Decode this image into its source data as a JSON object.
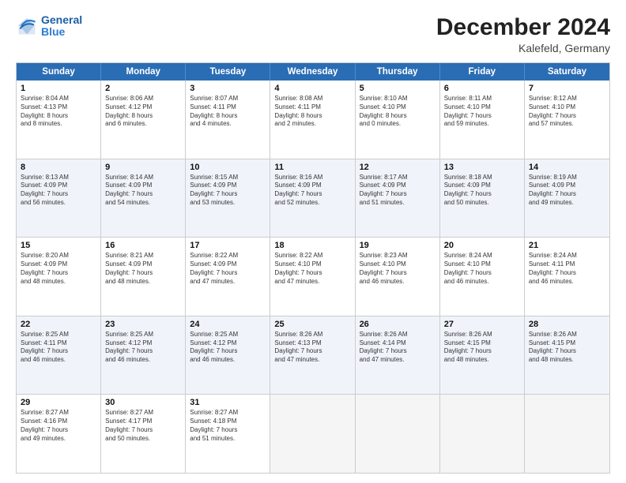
{
  "header": {
    "logo_general": "General",
    "logo_blue": "Blue",
    "month_title": "December 2024",
    "location": "Kalefeld, Germany"
  },
  "days_of_week": [
    "Sunday",
    "Monday",
    "Tuesday",
    "Wednesday",
    "Thursday",
    "Friday",
    "Saturday"
  ],
  "weeks": [
    [
      {
        "day": "1",
        "lines": [
          "Sunrise: 8:04 AM",
          "Sunset: 4:13 PM",
          "Daylight: 8 hours",
          "and 8 minutes."
        ]
      },
      {
        "day": "2",
        "lines": [
          "Sunrise: 8:06 AM",
          "Sunset: 4:12 PM",
          "Daylight: 8 hours",
          "and 6 minutes."
        ]
      },
      {
        "day": "3",
        "lines": [
          "Sunrise: 8:07 AM",
          "Sunset: 4:11 PM",
          "Daylight: 8 hours",
          "and 4 minutes."
        ]
      },
      {
        "day": "4",
        "lines": [
          "Sunrise: 8:08 AM",
          "Sunset: 4:11 PM",
          "Daylight: 8 hours",
          "and 2 minutes."
        ]
      },
      {
        "day": "5",
        "lines": [
          "Sunrise: 8:10 AM",
          "Sunset: 4:10 PM",
          "Daylight: 8 hours",
          "and 0 minutes."
        ]
      },
      {
        "day": "6",
        "lines": [
          "Sunrise: 8:11 AM",
          "Sunset: 4:10 PM",
          "Daylight: 7 hours",
          "and 59 minutes."
        ]
      },
      {
        "day": "7",
        "lines": [
          "Sunrise: 8:12 AM",
          "Sunset: 4:10 PM",
          "Daylight: 7 hours",
          "and 57 minutes."
        ]
      }
    ],
    [
      {
        "day": "8",
        "lines": [
          "Sunrise: 8:13 AM",
          "Sunset: 4:09 PM",
          "Daylight: 7 hours",
          "and 56 minutes."
        ]
      },
      {
        "day": "9",
        "lines": [
          "Sunrise: 8:14 AM",
          "Sunset: 4:09 PM",
          "Daylight: 7 hours",
          "and 54 minutes."
        ]
      },
      {
        "day": "10",
        "lines": [
          "Sunrise: 8:15 AM",
          "Sunset: 4:09 PM",
          "Daylight: 7 hours",
          "and 53 minutes."
        ]
      },
      {
        "day": "11",
        "lines": [
          "Sunrise: 8:16 AM",
          "Sunset: 4:09 PM",
          "Daylight: 7 hours",
          "and 52 minutes."
        ]
      },
      {
        "day": "12",
        "lines": [
          "Sunrise: 8:17 AM",
          "Sunset: 4:09 PM",
          "Daylight: 7 hours",
          "and 51 minutes."
        ]
      },
      {
        "day": "13",
        "lines": [
          "Sunrise: 8:18 AM",
          "Sunset: 4:09 PM",
          "Daylight: 7 hours",
          "and 50 minutes."
        ]
      },
      {
        "day": "14",
        "lines": [
          "Sunrise: 8:19 AM",
          "Sunset: 4:09 PM",
          "Daylight: 7 hours",
          "and 49 minutes."
        ]
      }
    ],
    [
      {
        "day": "15",
        "lines": [
          "Sunrise: 8:20 AM",
          "Sunset: 4:09 PM",
          "Daylight: 7 hours",
          "and 48 minutes."
        ]
      },
      {
        "day": "16",
        "lines": [
          "Sunrise: 8:21 AM",
          "Sunset: 4:09 PM",
          "Daylight: 7 hours",
          "and 48 minutes."
        ]
      },
      {
        "day": "17",
        "lines": [
          "Sunrise: 8:22 AM",
          "Sunset: 4:09 PM",
          "Daylight: 7 hours",
          "and 47 minutes."
        ]
      },
      {
        "day": "18",
        "lines": [
          "Sunrise: 8:22 AM",
          "Sunset: 4:10 PM",
          "Daylight: 7 hours",
          "and 47 minutes."
        ]
      },
      {
        "day": "19",
        "lines": [
          "Sunrise: 8:23 AM",
          "Sunset: 4:10 PM",
          "Daylight: 7 hours",
          "and 46 minutes."
        ]
      },
      {
        "day": "20",
        "lines": [
          "Sunrise: 8:24 AM",
          "Sunset: 4:10 PM",
          "Daylight: 7 hours",
          "and 46 minutes."
        ]
      },
      {
        "day": "21",
        "lines": [
          "Sunrise: 8:24 AM",
          "Sunset: 4:11 PM",
          "Daylight: 7 hours",
          "and 46 minutes."
        ]
      }
    ],
    [
      {
        "day": "22",
        "lines": [
          "Sunrise: 8:25 AM",
          "Sunset: 4:11 PM",
          "Daylight: 7 hours",
          "and 46 minutes."
        ]
      },
      {
        "day": "23",
        "lines": [
          "Sunrise: 8:25 AM",
          "Sunset: 4:12 PM",
          "Daylight: 7 hours",
          "and 46 minutes."
        ]
      },
      {
        "day": "24",
        "lines": [
          "Sunrise: 8:25 AM",
          "Sunset: 4:12 PM",
          "Daylight: 7 hours",
          "and 46 minutes."
        ]
      },
      {
        "day": "25",
        "lines": [
          "Sunrise: 8:26 AM",
          "Sunset: 4:13 PM",
          "Daylight: 7 hours",
          "and 47 minutes."
        ]
      },
      {
        "day": "26",
        "lines": [
          "Sunrise: 8:26 AM",
          "Sunset: 4:14 PM",
          "Daylight: 7 hours",
          "and 47 minutes."
        ]
      },
      {
        "day": "27",
        "lines": [
          "Sunrise: 8:26 AM",
          "Sunset: 4:15 PM",
          "Daylight: 7 hours",
          "and 48 minutes."
        ]
      },
      {
        "day": "28",
        "lines": [
          "Sunrise: 8:26 AM",
          "Sunset: 4:15 PM",
          "Daylight: 7 hours",
          "and 48 minutes."
        ]
      }
    ],
    [
      {
        "day": "29",
        "lines": [
          "Sunrise: 8:27 AM",
          "Sunset: 4:16 PM",
          "Daylight: 7 hours",
          "and 49 minutes."
        ]
      },
      {
        "day": "30",
        "lines": [
          "Sunrise: 8:27 AM",
          "Sunset: 4:17 PM",
          "Daylight: 7 hours",
          "and 50 minutes."
        ]
      },
      {
        "day": "31",
        "lines": [
          "Sunrise: 8:27 AM",
          "Sunset: 4:18 PM",
          "Daylight: 7 hours",
          "and 51 minutes."
        ]
      },
      {
        "day": "",
        "lines": []
      },
      {
        "day": "",
        "lines": []
      },
      {
        "day": "",
        "lines": []
      },
      {
        "day": "",
        "lines": []
      }
    ]
  ]
}
